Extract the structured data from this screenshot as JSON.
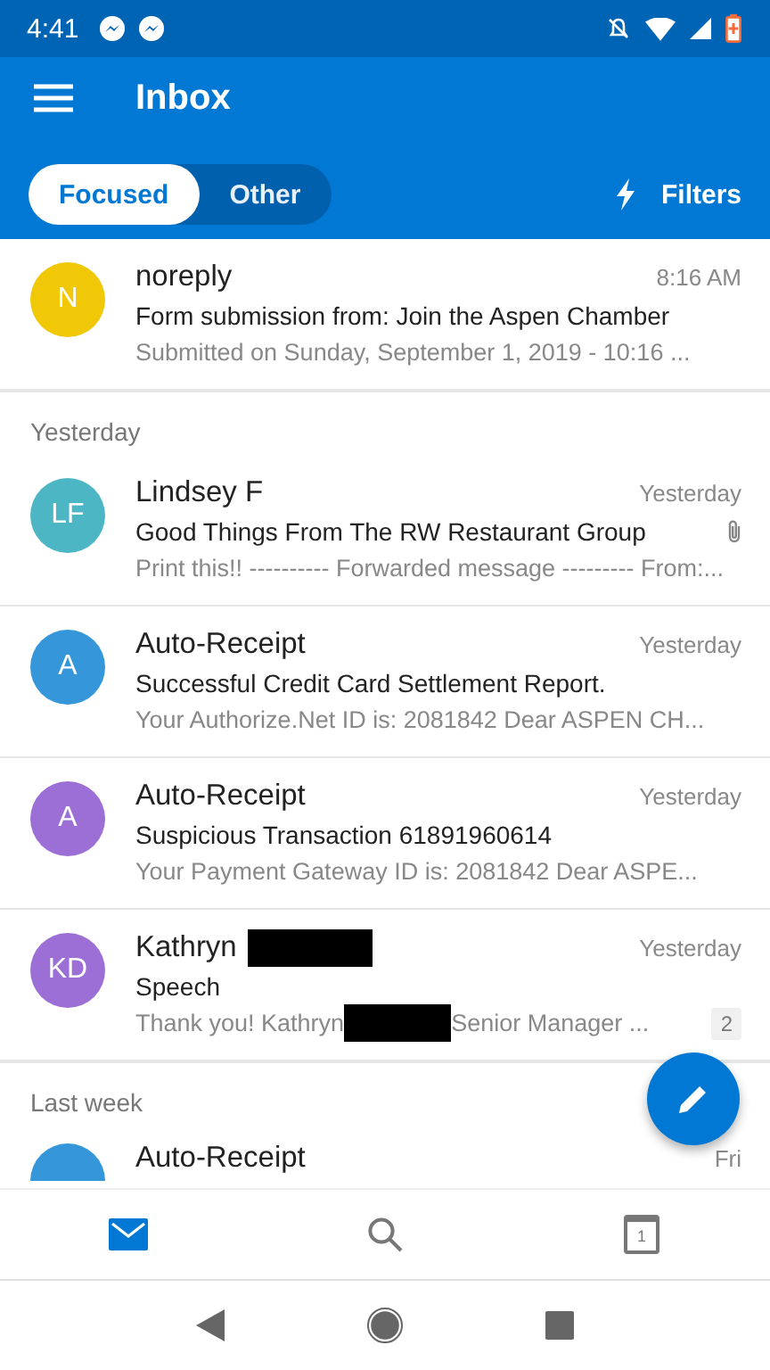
{
  "status_bar": {
    "time": "4:41"
  },
  "app_bar": {
    "title": "Inbox",
    "filters": "Filters"
  },
  "tabs": [
    {
      "label": "Focused",
      "selected": true
    },
    {
      "label": "Other",
      "selected": false
    }
  ],
  "sections": [
    {
      "emails": [
        {
          "initials": "N",
          "color": "#f0c808",
          "sender": [
            {
              "kind": "text",
              "text": "noreply"
            }
          ],
          "time": "8:16 AM",
          "subject": "Form submission from: Join the Aspen Chamber",
          "preview": [
            {
              "kind": "text",
              "text": "Submitted on Sunday, September 1, 2019 - 10:16 ..."
            }
          ],
          "attachment": false
        }
      ]
    },
    {
      "heading": "Yesterday",
      "emails": [
        {
          "initials": "LF",
          "color": "#4db6c4",
          "sender": [
            {
              "kind": "text",
              "text": "Lindsey F"
            }
          ],
          "time": "Yesterday",
          "subject": "Good Things From The RW Restaurant Group",
          "preview": [
            {
              "kind": "text",
              "text": "Print this!! ---------- Forwarded message --------- From:..."
            }
          ],
          "attachment": true
        },
        {
          "initials": "A",
          "color": "#3596d9",
          "sender": [
            {
              "kind": "text",
              "text": "Auto-Receipt"
            }
          ],
          "time": "Yesterday",
          "subject": "Successful Credit Card Settlement Report.",
          "preview": [
            {
              "kind": "text",
              "text": "Your Authorize.Net ID is: 2081842 Dear ASPEN CH..."
            }
          ],
          "attachment": false
        },
        {
          "initials": "A",
          "color": "#9c6fd6",
          "sender": [
            {
              "kind": "text",
              "text": "Auto-Receipt"
            }
          ],
          "time": "Yesterday",
          "subject": "Suspicious Transaction 61891960614",
          "preview": [
            {
              "kind": "text",
              "text": "Your Payment Gateway ID is: 2081842 Dear ASPE..."
            }
          ],
          "attachment": false
        },
        {
          "initials": "KD",
          "color": "#9c6fd6",
          "sender": [
            {
              "kind": "text",
              "text": "Kathryn"
            },
            {
              "kind": "redaction"
            }
          ],
          "time": "Yesterday",
          "subject": "Speech",
          "preview": [
            {
              "kind": "text",
              "text": "Thank you! Kathryn"
            },
            {
              "kind": "redaction"
            },
            {
              "kind": "text",
              "text": "Senior Manager ..."
            }
          ],
          "attachment": false,
          "count": "2"
        }
      ]
    },
    {
      "heading": "Last week",
      "emails": [
        {
          "color": "#3596d9",
          "sender": [
            {
              "kind": "text",
              "text": "Auto-Receipt"
            }
          ],
          "time": "Fri"
        }
      ]
    }
  ],
  "bottom_nav": [
    {
      "kind": "mail",
      "selected": true
    },
    {
      "kind": "search",
      "selected": false
    },
    {
      "kind": "calendar",
      "selected": false,
      "text": "1"
    }
  ]
}
